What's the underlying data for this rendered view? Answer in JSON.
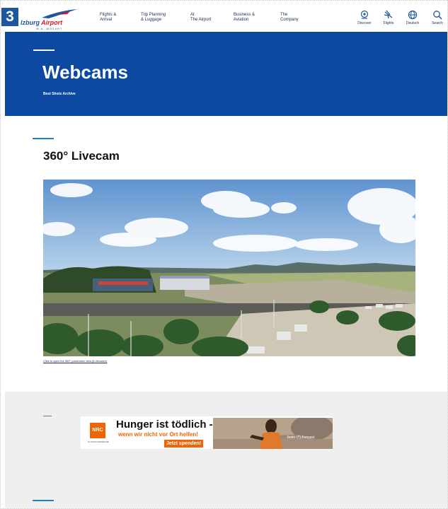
{
  "badge": {
    "number": "3"
  },
  "header": {
    "logo_blue": "lzburg",
    "logo_red": "Airport",
    "logo_sub": "W.A. MOZART",
    "nav": [
      "Flights &\nArrival",
      "Trip Planning\n& Luggage",
      "At\nThe Airport",
      "Business &\nAviation",
      "The\nCompany"
    ],
    "tools": [
      {
        "label": "Discover",
        "icon": "location-pin-icon"
      },
      {
        "label": "Flights",
        "icon": "plane-icon"
      },
      {
        "label": "Deutsch",
        "icon": "globe-icon"
      },
      {
        "label": "Search",
        "icon": "search-icon"
      }
    ]
  },
  "hero": {
    "title": "Webcams",
    "link": "Best Shots Archive"
  },
  "section": {
    "title": "360° Livecam",
    "caption": "Click to open the 360° panoramic view (in browser)"
  },
  "ad": {
    "logo": "NRC",
    "logo_sub": "FLÜCHTLINGSHILFE",
    "headline": "Hunger ist tödlich -",
    "subline": "wenn wir nicht vor Ort helfen!",
    "button": "Jetzt spenden!",
    "photo_caption": "Jeder (?) Kenyani"
  },
  "colors": {
    "brand_blue": "#0d49a0",
    "accent_line": "#1e7fd1",
    "ad_orange": "#ec6608"
  }
}
